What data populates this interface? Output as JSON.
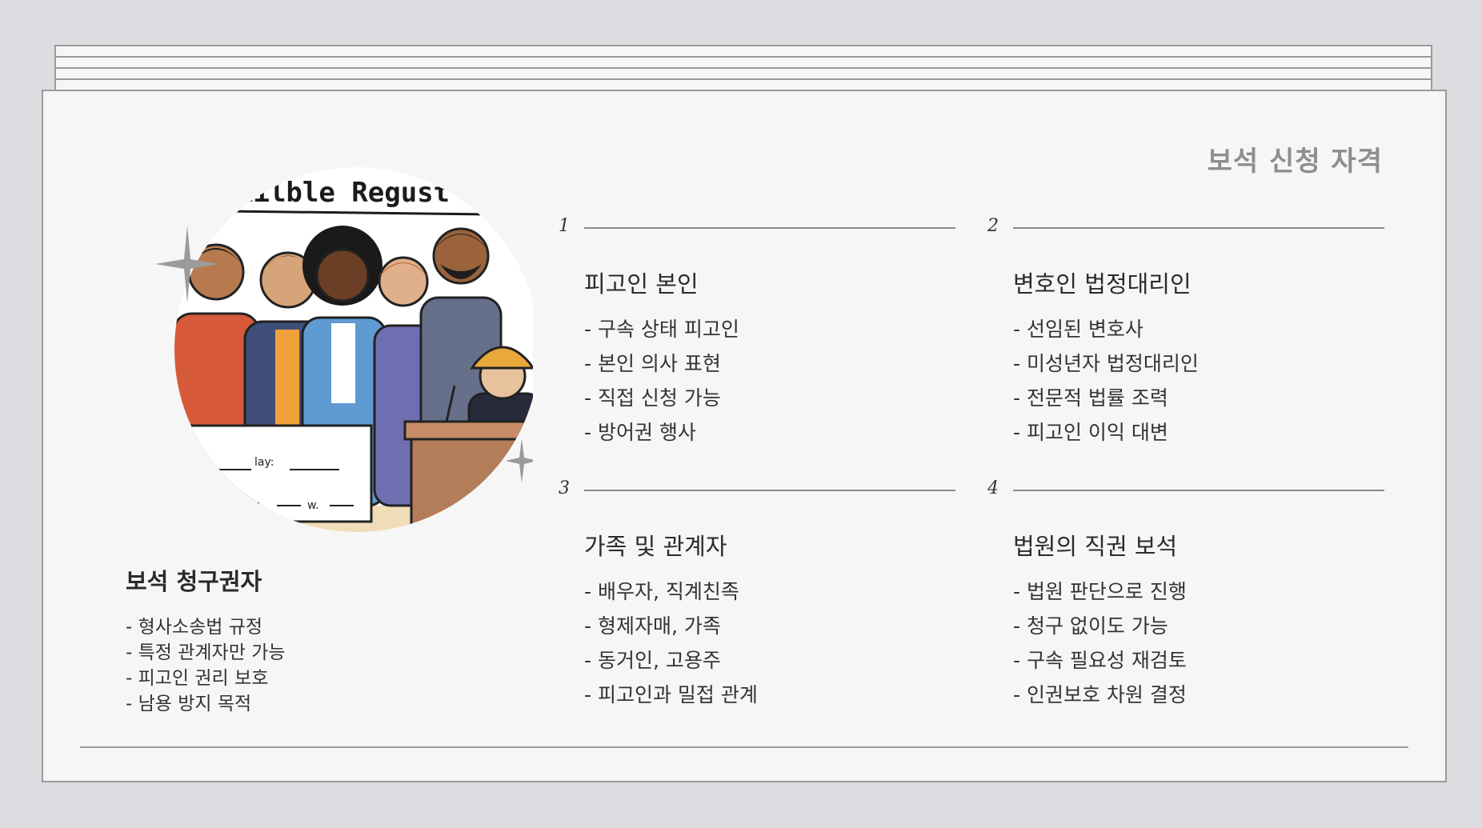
{
  "slide": {
    "title": "보석 신청 자격"
  },
  "illustration": {
    "banner_text": "ıilble Regust b.",
    "paper_text_1": "lay:",
    "paper_text_2": "is.",
    "paper_text_3": "w."
  },
  "left": {
    "heading": "보석 청구권자",
    "items": [
      "- 형사소송법 규정",
      "- 특정 관계자만 가능",
      "- 피고인 권리 보호",
      "- 남용 방지 목적"
    ]
  },
  "sections": [
    {
      "number": "1",
      "heading": "피고인 본인",
      "items": [
        "- 구속 상태 피고인",
        "- 본인 의사 표현",
        "- 직접 신청 가능",
        "- 방어권 행사"
      ]
    },
    {
      "number": "2",
      "heading": "변호인 법정대리인",
      "items": [
        "- 선임된 변호사",
        "- 미성년자 법정대리인",
        "- 전문적 법률 조력",
        "- 피고인 이익 대변"
      ]
    },
    {
      "number": "3",
      "heading": "가족 및 관계자",
      "items": [
        "- 배우자, 직계친족",
        "- 형제자매, 가족",
        "- 동거인, 고용주",
        "- 피고인과 밀접 관계"
      ]
    },
    {
      "number": "4",
      "heading": "법원의 직권 보석",
      "items": [
        "- 법원 판단으로 진행",
        "- 청구 없이도 가능",
        "- 구속 필요성 재검토",
        "- 인권보호 차원 결정"
      ]
    }
  ]
}
